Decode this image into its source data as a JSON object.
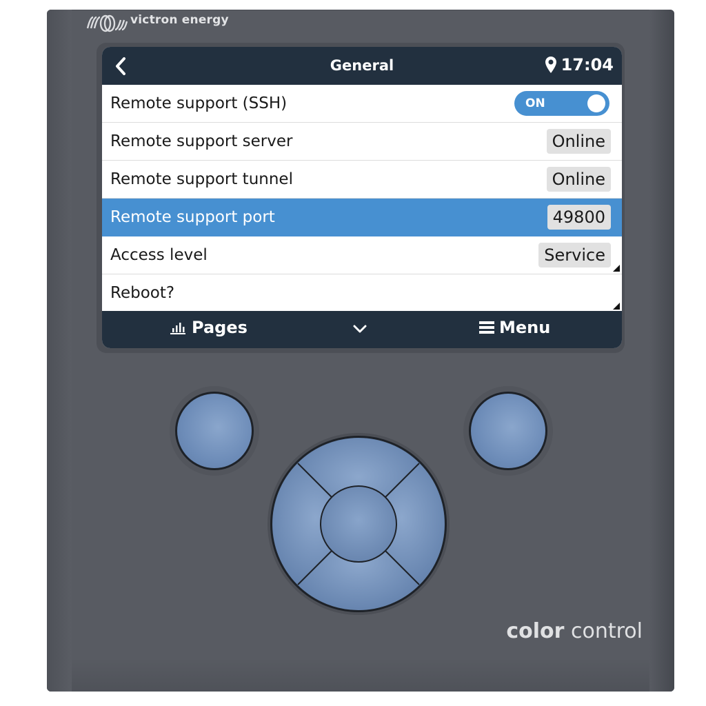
{
  "device": {
    "brand_logo_text": "victron energy",
    "product_name_bold": "color",
    "product_name_light": "control"
  },
  "screen": {
    "header": {
      "back_icon": "chevron-left-icon",
      "title": "General",
      "location_icon": "map-pin-icon",
      "time": "17:04"
    },
    "rows": [
      {
        "label": "Remote support (SSH)",
        "type": "toggle",
        "value": "ON"
      },
      {
        "label": "Remote support server",
        "type": "value",
        "value": "Online"
      },
      {
        "label": "Remote support tunnel",
        "type": "value",
        "value": "Online"
      },
      {
        "label": "Remote support port",
        "type": "value",
        "value": "49800",
        "selected": true
      },
      {
        "label": "Access level",
        "type": "value",
        "value": "Service",
        "has_submenu": true
      },
      {
        "label": "Reboot?",
        "type": "action",
        "has_submenu": true
      }
    ],
    "footer": {
      "pages_icon": "bar-chart-icon",
      "pages_label": "Pages",
      "down_icon": "chevron-down-icon",
      "menu_icon": "hamburger-icon",
      "menu_label": "Menu"
    }
  },
  "colors": {
    "header_bg": "#22303f",
    "selected_row": "#4790d1",
    "toggle_on": "#4790d1",
    "device_body": "#585b62",
    "button_blue": "#7390b9"
  }
}
